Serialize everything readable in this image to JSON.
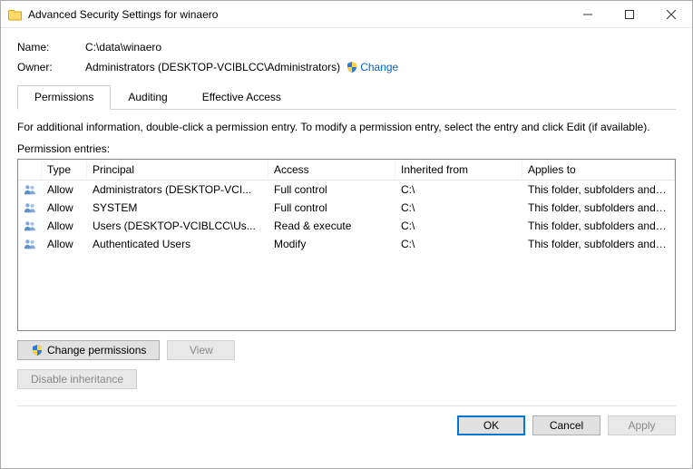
{
  "window": {
    "title": "Advanced Security Settings for winaero"
  },
  "fields": {
    "name_label": "Name:",
    "name_value": "C:\\data\\winaero",
    "owner_label": "Owner:",
    "owner_value": "Administrators (DESKTOP-VCIBLCC\\Administrators)",
    "change_link": "Change"
  },
  "tabs": {
    "permissions": "Permissions",
    "auditing": "Auditing",
    "effective": "Effective Access"
  },
  "info_text": "For additional information, double-click a permission entry. To modify a permission entry, select the entry and click Edit (if available).",
  "section_label": "Permission entries:",
  "columns": {
    "type": "Type",
    "principal": "Principal",
    "access": "Access",
    "inherited": "Inherited from",
    "applies": "Applies to"
  },
  "entries": [
    {
      "type": "Allow",
      "principal": "Administrators (DESKTOP-VCI...",
      "access": "Full control",
      "inherited": "C:\\",
      "applies": "This folder, subfolders and files"
    },
    {
      "type": "Allow",
      "principal": "SYSTEM",
      "access": "Full control",
      "inherited": "C:\\",
      "applies": "This folder, subfolders and files"
    },
    {
      "type": "Allow",
      "principal": "Users (DESKTOP-VCIBLCC\\Us...",
      "access": "Read & execute",
      "inherited": "C:\\",
      "applies": "This folder, subfolders and files"
    },
    {
      "type": "Allow",
      "principal": "Authenticated Users",
      "access": "Modify",
      "inherited": "C:\\",
      "applies": "This folder, subfolders and files"
    }
  ],
  "buttons": {
    "change_perm": "Change permissions",
    "view": "View",
    "disable_inherit": "Disable inheritance",
    "ok": "OK",
    "cancel": "Cancel",
    "apply": "Apply"
  }
}
